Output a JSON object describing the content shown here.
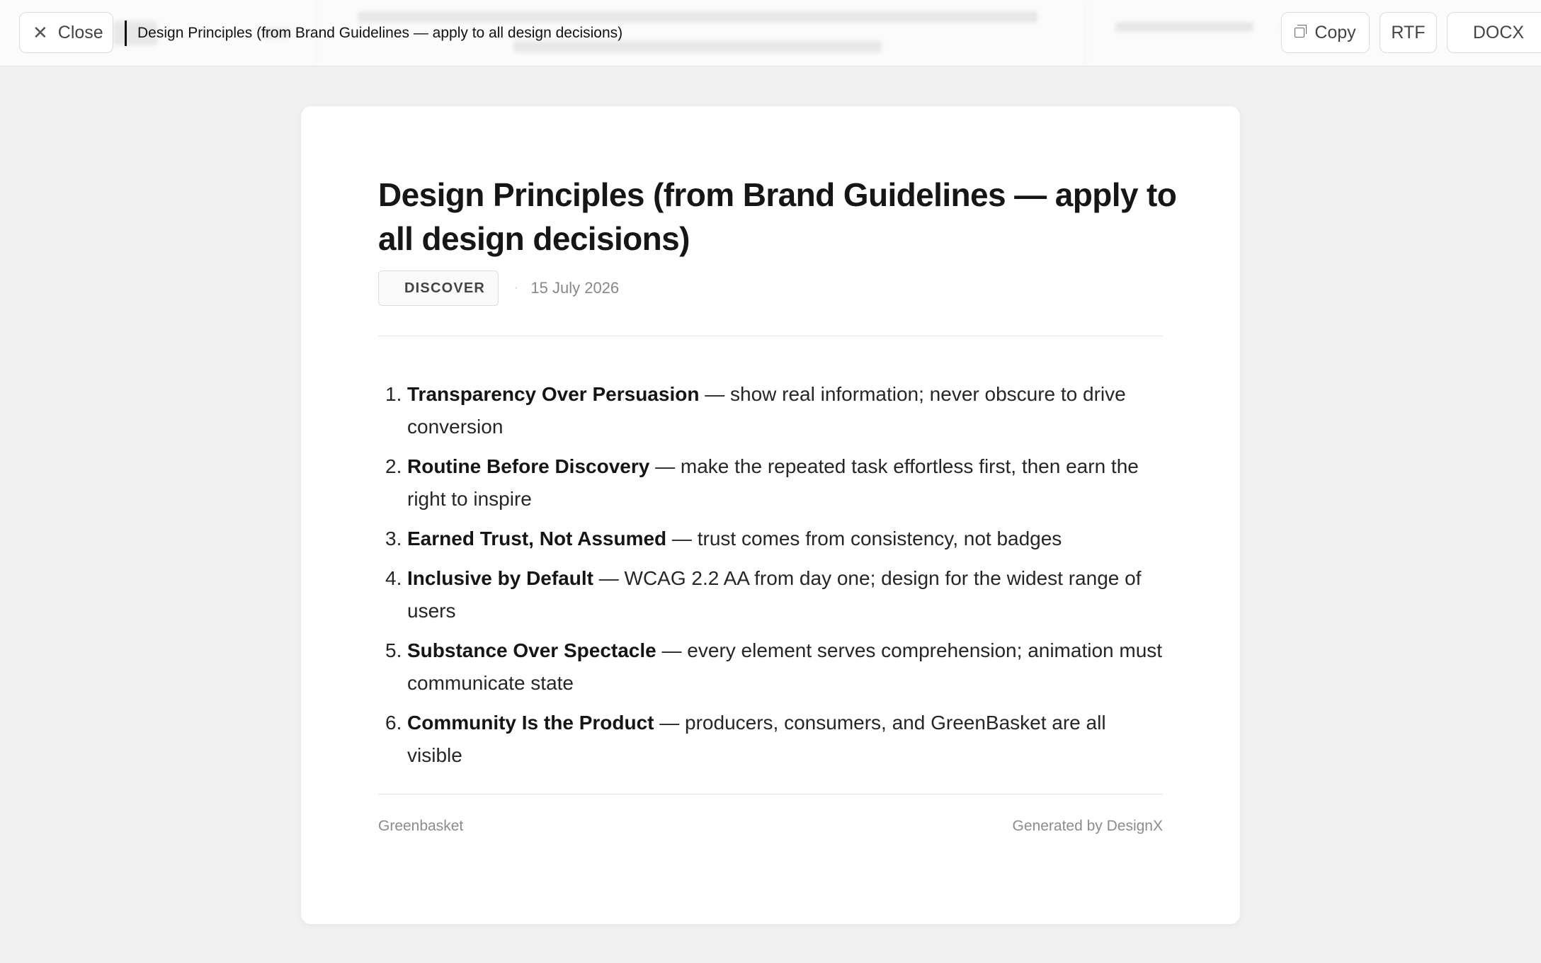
{
  "toolbar": {
    "close_label": "Close",
    "document_title": "Design Principles (from Brand Guidelines — apply to all design decisions)",
    "copy_label": "Copy",
    "rtf_label": "RTF",
    "docx_label": "DOCX",
    "icons": {
      "close": "close-icon",
      "copy": "copy-icon"
    }
  },
  "document": {
    "title": "Design Principles (from Brand Guidelines — apply to all design decisions)",
    "tag": "DISCOVER",
    "separator": "·",
    "date": "15 July 2026",
    "principles": [
      {
        "number": "1.",
        "title": "Transparency Over Persuasion",
        "text": " — show real information; never obscure to drive conversion"
      },
      {
        "number": "2.",
        "title": "Routine Before Discovery",
        "text": " — make the repeated task effortless first, then earn the right to inspire"
      },
      {
        "number": "3.",
        "title": "Earned Trust, Not Assumed",
        "text": " — trust comes from consistency, not badges"
      },
      {
        "number": "4.",
        "title": "Inclusive by Default",
        "text": " — WCAG 2.2 AA from day one; design for the widest range of users"
      },
      {
        "number": "5.",
        "title": "Substance Over Spectacle",
        "text": " — every element serves comprehension; animation must communicate state"
      },
      {
        "number": "6.",
        "title": "Community Is the Product",
        "text": " — producers, consumers, and GreenBasket are all visible"
      }
    ],
    "footer_left": "Greenbasket",
    "footer_right": "Generated by DesignX"
  },
  "colors": {
    "page_background": "#f1f1f1",
    "card_background": "#ffffff",
    "text_primary": "#161616",
    "text_muted": "#888888",
    "border": "#dddddd"
  }
}
